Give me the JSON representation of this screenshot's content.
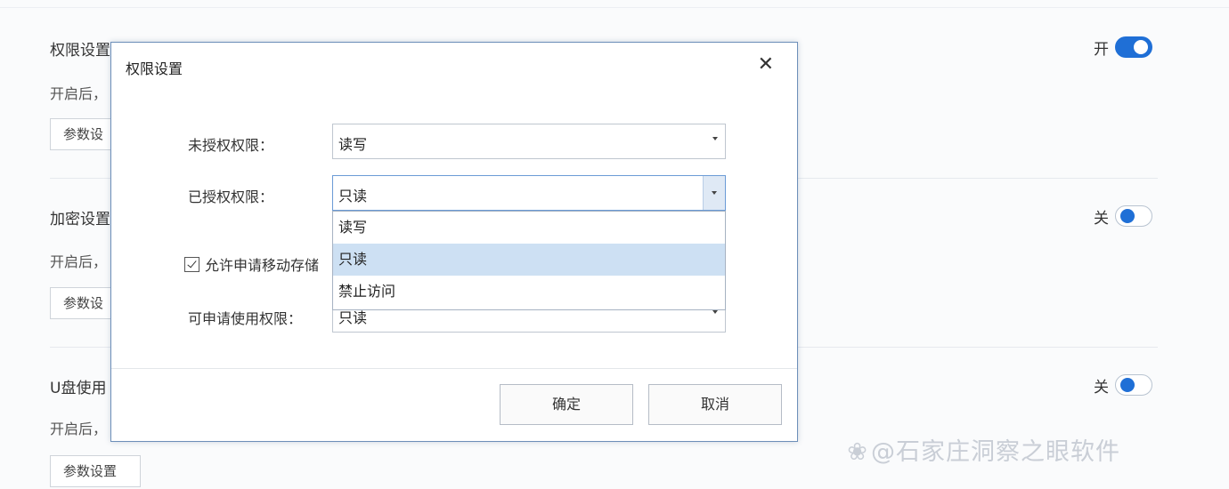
{
  "background": {
    "sections": [
      {
        "title": "权限设置",
        "desc": "开启后，",
        "button": "参数设",
        "toggle_label": "开",
        "toggle_on": true
      },
      {
        "title": "加密设置",
        "desc": "开启后，",
        "button": "参数设",
        "toggle_label": "关",
        "toggle_on": false
      },
      {
        "title": "U盘使用",
        "desc": "开启后，",
        "button": "参数设置",
        "toggle_label": "关",
        "toggle_on": false
      }
    ]
  },
  "dialog": {
    "title": "权限设置",
    "close_icon": "close-icon",
    "unauthorized_label": "未授权权限：",
    "unauthorized_value": "读写",
    "authorized_label": "已授权权限：",
    "authorized_value": "只读",
    "dropdown_options": [
      "读写",
      "只读",
      "禁止访问"
    ],
    "dropdown_selected": "只读",
    "checkbox_label": "允许申请移动存储",
    "checkbox_checked": true,
    "apply_label": "可申请使用权限：",
    "apply_value": "只读",
    "ok_label": "确定",
    "cancel_label": "取消"
  },
  "colors": {
    "toggle_on": "#1f6fd6",
    "dropdown_selected_bg": "#cde0f3",
    "dialog_border": "#6d8fb9"
  },
  "watermark": "@石家庄洞察之眼软件"
}
